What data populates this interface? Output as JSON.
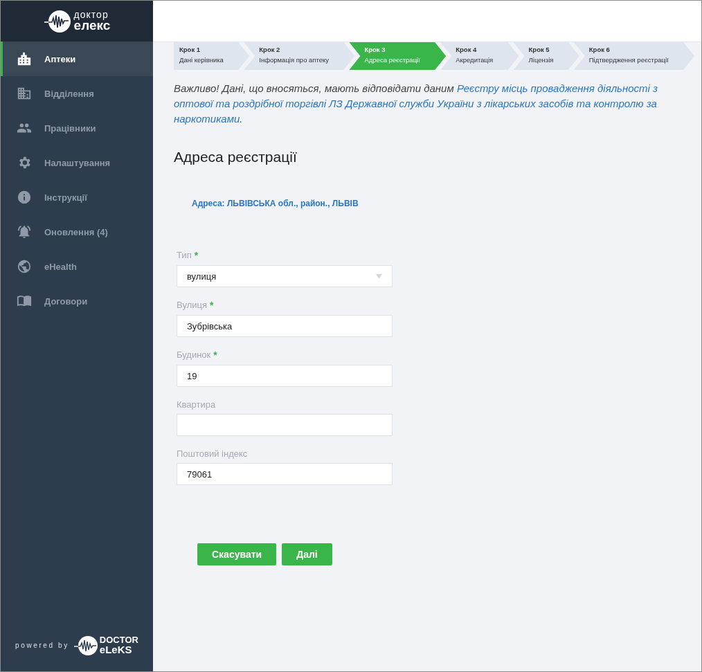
{
  "logo": {
    "line_1": "доктор",
    "line_2": "елекс"
  },
  "sidebar": {
    "items": [
      {
        "label": "Аптеки",
        "selected": true
      },
      {
        "label": "Відділення",
        "selected": false
      },
      {
        "label": "Працівники",
        "selected": false
      },
      {
        "label": "Налаштування",
        "selected": false
      },
      {
        "label": "Інструкції",
        "selected": false
      },
      {
        "label": "Оновлення (4)",
        "selected": false
      },
      {
        "label": "eHealth",
        "selected": false
      },
      {
        "label": "Договори",
        "selected": false
      }
    ],
    "footer": {
      "powered_by": "powered by",
      "brand_line_1": "DOCTOR",
      "brand_line_2": "eLeKS"
    }
  },
  "steps": [
    {
      "number": "Крок 1",
      "label": "Дані керівника",
      "selected": false
    },
    {
      "number": "Крок 2",
      "label": "Інформація про аптеку",
      "selected": false
    },
    {
      "number": "Крок 3",
      "label": "Адреса реєстрації",
      "selected": true
    },
    {
      "number": "Крок 4",
      "label": "Акредитація",
      "selected": false
    },
    {
      "number": "Крок 5",
      "label": "Ліцензія",
      "selected": false
    },
    {
      "number": "Крок 6",
      "label": "Підтвердження реєстрації",
      "selected": false
    }
  ],
  "notice": {
    "text": "Важливо! Дані, що вносяться, мають відповідати даним ",
    "link_lines": [
      "Реєстру місць провадження діяльності з",
      "оптової та роздрібної торгівлі ЛЗ Державної служби України з лікарських засобів та контролю за",
      "наркотиками"
    ],
    "end": "."
  },
  "heading": "Адреса реєстрації",
  "address": "Адреса: ЛЬВІВСЬКА обл., район., ЛЬВІВ",
  "fields": [
    {
      "kind": "select",
      "label": "Тип",
      "required_mark": "*",
      "value": "вулиця"
    },
    {
      "kind": "text",
      "label": "Вулиця",
      "required_mark": "*",
      "value": "Зубрівська"
    },
    {
      "kind": "text",
      "label": "Будинок",
      "required_mark": "*",
      "value": "19"
    },
    {
      "kind": "text",
      "label": "Квартира"
    },
    {
      "kind": "text",
      "label": "Поштовий індекс",
      "value": "79061"
    }
  ],
  "buttons": [
    "Скасувати",
    "Далі"
  ]
}
